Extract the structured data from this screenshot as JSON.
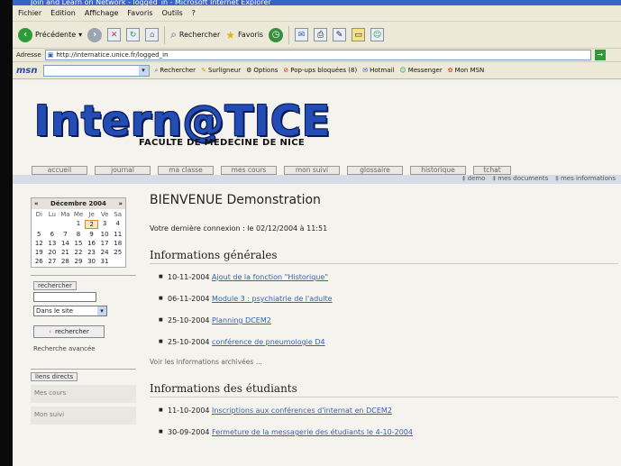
{
  "window": {
    "title": "Join and Learn on Network - logged_in - Microsoft Internet Explorer"
  },
  "menu": [
    "Fichier",
    "Edition",
    "Affichage",
    "Favoris",
    "Outils",
    "?"
  ],
  "toolbar": {
    "back": "Précédente",
    "search": "Rechercher",
    "favorites": "Favoris"
  },
  "address": {
    "label": "Adresse",
    "url": "http://internatice.unice.fr/logged_in"
  },
  "msnbar": {
    "logo": "msn",
    "search_btn": "Rechercher",
    "highlight": "Surligneur",
    "options": "Options",
    "popups": "Pop-ups bloquées (8)",
    "hotmail": "Hotmail",
    "messenger": "Messenger",
    "mymsn": "Mon MSN"
  },
  "site": {
    "logo": "Intern@TICE",
    "subtitle": "FACULTE DE MEDECINE DE NICE",
    "tabs": [
      "accueil",
      "journal",
      "ma classe",
      "mes cours",
      "mon suivi",
      "glossaire",
      "historique",
      "tchat"
    ],
    "subnav": [
      "demo",
      "mes documents",
      "mes informations"
    ]
  },
  "calendar": {
    "month": "Décembre 2004",
    "prev": "«",
    "next": "»",
    "dow": [
      "Di",
      "Lu",
      "Ma",
      "Me",
      "Je",
      "Ve",
      "Sa"
    ],
    "days": [
      "",
      "",
      "",
      "1",
      "2",
      "3",
      "4",
      "5",
      "6",
      "7",
      "8",
      "9",
      "10",
      "11",
      "12",
      "13",
      "14",
      "15",
      "16",
      "17",
      "18",
      "19",
      "20",
      "21",
      "22",
      "23",
      "24",
      "25",
      "26",
      "27",
      "28",
      "29",
      "30",
      "31",
      ""
    ],
    "today": "2"
  },
  "search": {
    "title": "rechercher",
    "scope": "Dans le site",
    "button": "rechercher",
    "advanced": "Recherche avancée"
  },
  "links": {
    "title": "liens directs",
    "items": [
      "Mes cours",
      "Mon suivi"
    ]
  },
  "main": {
    "welcome": "BIENVENUE Demonstration",
    "last_connection": "Votre dernière connexion : le 02/12/2004 à 11:51",
    "general_title": "Informations générales",
    "general": [
      {
        "date": "10-11-2004",
        "text": "Ajout de la fonction \"Historique\""
      },
      {
        "date": "06-11-2004",
        "text": "Module 3 : psychiatrie de l'adulte"
      },
      {
        "date": "25-10-2004",
        "text": "Planning DCEM2"
      },
      {
        "date": "25-10-2004",
        "text": "conférence de pneumologie D4"
      }
    ],
    "archive": "Voir les informations archivées ...",
    "students_title": "Informations des étudiants",
    "students": [
      {
        "date": "11-10-2004",
        "text": "Inscriptions aux conférences d'internat en DCEM2"
      },
      {
        "date": "30-09-2004",
        "text": "Fermeture de la messagerie des étudiants le 4-10-2004"
      }
    ]
  }
}
